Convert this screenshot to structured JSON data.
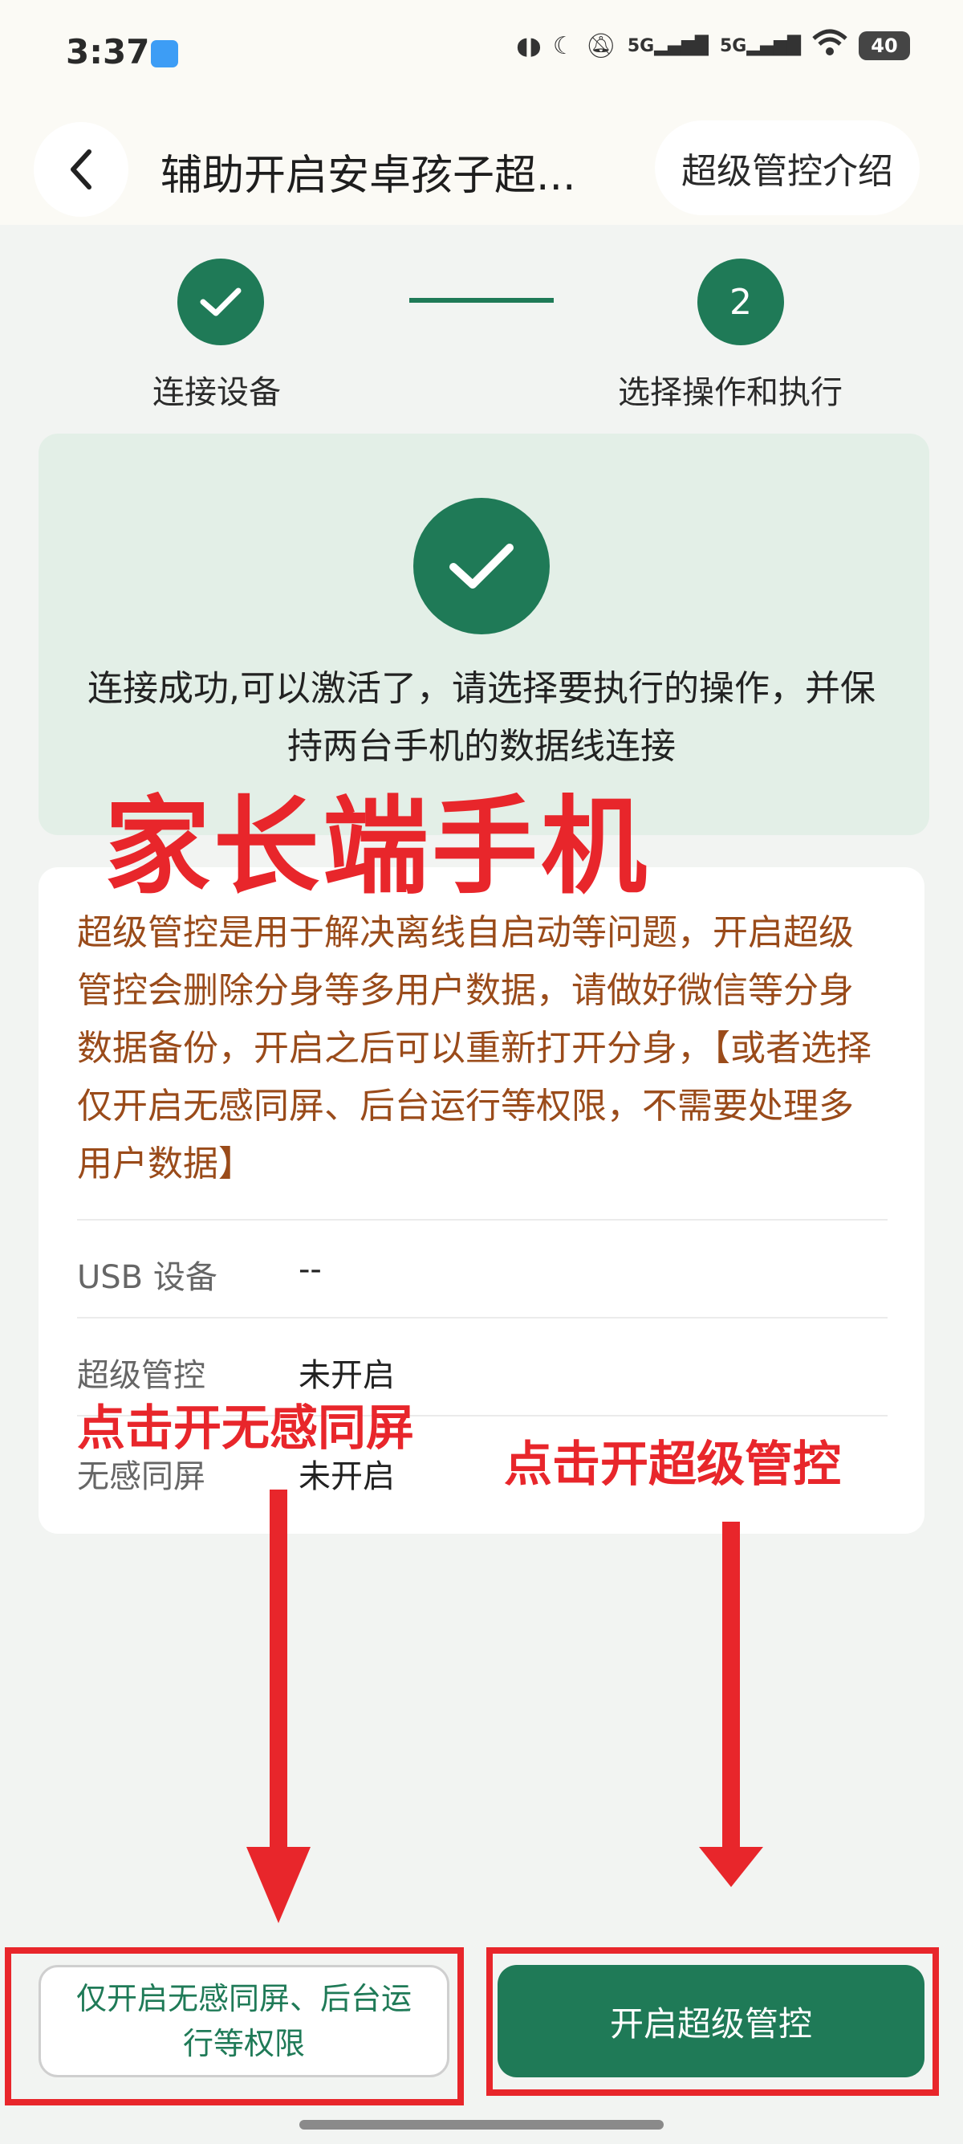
{
  "status_bar": {
    "time": "3:37",
    "battery": "40",
    "icons": [
      "earbuds-icon",
      "moon-icon",
      "mute-icon",
      "signal-5g-icon",
      "signal-5g-icon",
      "wifi-icon"
    ],
    "signal_label": "5G"
  },
  "header": {
    "title": "辅助开启安卓孩子超...",
    "intro_button": "超级管控介绍"
  },
  "stepper": {
    "steps": [
      {
        "label": "连接设备",
        "state": "done"
      },
      {
        "label": "选择操作和执行",
        "number": "2",
        "state": "active"
      }
    ]
  },
  "success": {
    "message": "连接成功,可以激活了，请选择要执行的操作，并保持两台手机的数据线连接"
  },
  "info": {
    "warning": "超级管控是用于解决离线自启动等问题，开启超级管控会删除分身等多用户数据，请做好微信等分身数据备份，开启之后可以重新打开分身，【或者选择仅开启无感同屏、后台运行等权限，不需要处理多用户数据】",
    "rows": [
      {
        "label": "USB 设备",
        "value": "--"
      },
      {
        "label": "超级管控",
        "value": "未开启"
      },
      {
        "label": "无感同屏",
        "value": "未开启"
      }
    ]
  },
  "annotations": {
    "parent_phone": "家长端手机",
    "tap_screen": "点击开无感同屏",
    "tap_super": "点击开超级管控"
  },
  "actions": {
    "secondary": "仅开启无感同屏、后台运行等权限",
    "primary": "开启超级管控"
  },
  "colors": {
    "accent": "#1f7a57",
    "warning_text": "#9a4b1a",
    "annotation_red": "#e8262b",
    "success_panel": "#e3efe7"
  }
}
